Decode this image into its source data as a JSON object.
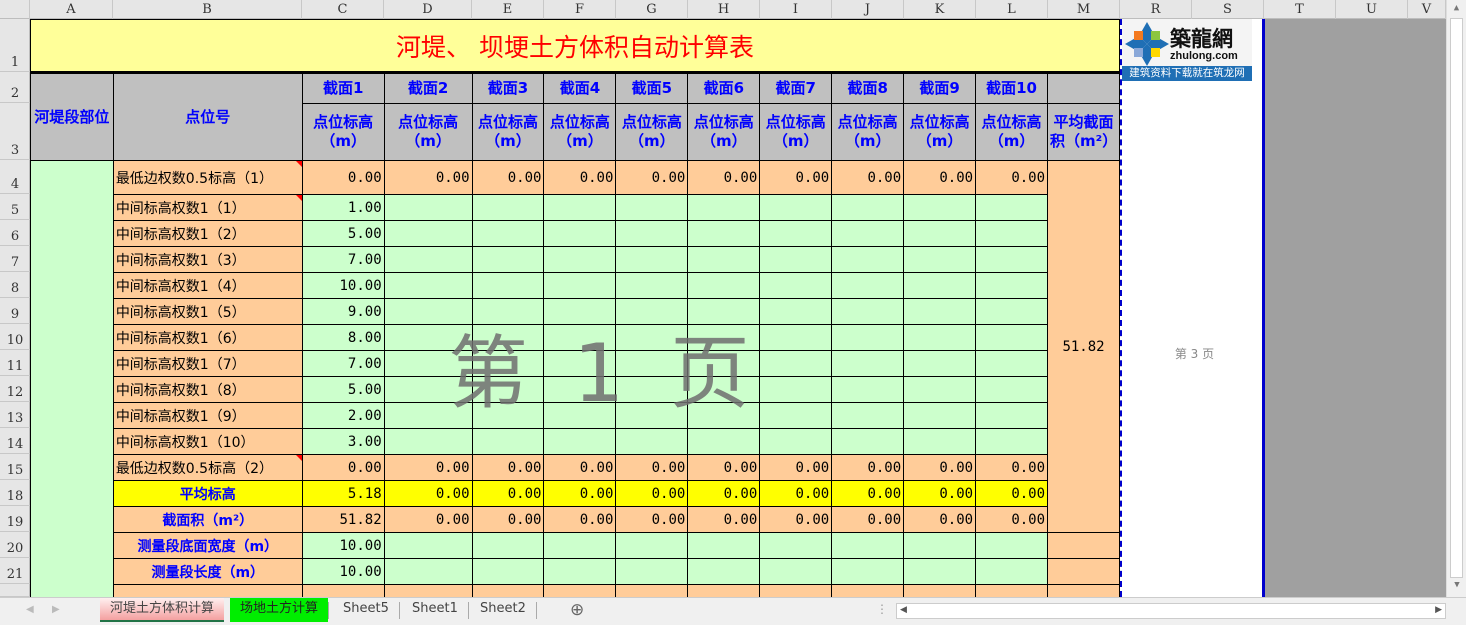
{
  "columns": [
    "A",
    "B",
    "C",
    "D",
    "E",
    "F",
    "G",
    "H",
    "I",
    "J",
    "K",
    "L",
    "M",
    "R",
    "S",
    "T",
    "U",
    "V"
  ],
  "row_numbers": [
    "1",
    "2",
    "3",
    "4",
    "5",
    "6",
    "7",
    "8",
    "9",
    "10",
    "11",
    "12",
    "13",
    "14",
    "15",
    "18",
    "19",
    "20",
    "21",
    ""
  ],
  "title": "河堤、 坝埂土方体积自动计算表",
  "headers": {
    "section_part": "河堤段部位",
    "point_no": "点位号",
    "sections": [
      "截面1",
      "截面2",
      "截面3",
      "截面4",
      "截面5",
      "截面6",
      "截面7",
      "截面8",
      "截面9",
      "截面10"
    ],
    "elevation": [
      "点位标高（m）",
      "点位标高（m）",
      "点位标高（m）",
      "点位标高（m）",
      "点位标高（m）",
      "点位标高（m）",
      "点位标高（m）",
      "点位标高（m）",
      "点位标高（m）",
      "点位标高（m）"
    ],
    "avg_area": "平均截面积（m²）"
  },
  "rows": [
    {
      "label": "最低边权数0.5标高（1）",
      "type": "edge",
      "values": [
        "0.00",
        "0.00",
        "0.00",
        "0.00",
        "0.00",
        "0.00",
        "0.00",
        "0.00",
        "0.00",
        "0.00"
      ]
    },
    {
      "label": "中间标高权数1（1）",
      "type": "mid",
      "values": [
        "1.00"
      ]
    },
    {
      "label": "中间标高权数1（2）",
      "type": "mid",
      "values": [
        "5.00"
      ]
    },
    {
      "label": "中间标高权数1（3）",
      "type": "mid",
      "values": [
        "7.00"
      ]
    },
    {
      "label": "中间标高权数1（4）",
      "type": "mid",
      "values": [
        "10.00"
      ]
    },
    {
      "label": "中间标高权数1（5）",
      "type": "mid",
      "values": [
        "9.00"
      ]
    },
    {
      "label": "中间标高权数1（6）",
      "type": "mid",
      "values": [
        "8.00"
      ]
    },
    {
      "label": "中间标高权数1（7）",
      "type": "mid",
      "values": [
        "7.00"
      ]
    },
    {
      "label": "中间标高权数1（8）",
      "type": "mid",
      "values": [
        "5.00"
      ]
    },
    {
      "label": "中间标高权数1（9）",
      "type": "mid",
      "values": [
        "2.00"
      ]
    },
    {
      "label": "中间标高权数1（10）",
      "type": "mid",
      "values": [
        "3.00"
      ]
    },
    {
      "label": "最低边权数0.5标高（2）",
      "type": "edge",
      "values": [
        "0.00",
        "0.00",
        "0.00",
        "0.00",
        "0.00",
        "0.00",
        "0.00",
        "0.00",
        "0.00",
        "0.00"
      ]
    },
    {
      "label": "平均标高",
      "type": "avg",
      "values": [
        "5.18",
        "0.00",
        "0.00",
        "0.00",
        "0.00",
        "0.00",
        "0.00",
        "0.00",
        "0.00",
        "0.00"
      ]
    },
    {
      "label": "截面积（m²）",
      "type": "area",
      "values": [
        "51.82",
        "0.00",
        "0.00",
        "0.00",
        "0.00",
        "0.00",
        "0.00",
        "0.00",
        "0.00",
        "0.00"
      ]
    },
    {
      "label": "测量段底面宽度（m）",
      "type": "input",
      "values": [
        "10.00"
      ]
    },
    {
      "label": "测量段长度（m）",
      "type": "input",
      "values": [
        "10.00"
      ]
    },
    {
      "label": "",
      "type": "partial",
      "values": []
    }
  ],
  "avg_area_value": "51.82",
  "watermark_page1": "第 1 页",
  "watermark_page3": "第 3 页",
  "logo": {
    "name": "築龍網",
    "url": "zhulong.com",
    "slogan": "建筑资料下载就在筑龙网"
  },
  "sheet_tabs": [
    {
      "label": "河堤土方体积计算",
      "active": true
    },
    {
      "label": "场地土方计算"
    },
    {
      "label": "Sheet5"
    },
    {
      "label": "Sheet1"
    },
    {
      "label": "Sheet2"
    }
  ],
  "add_sheet": "⊕"
}
